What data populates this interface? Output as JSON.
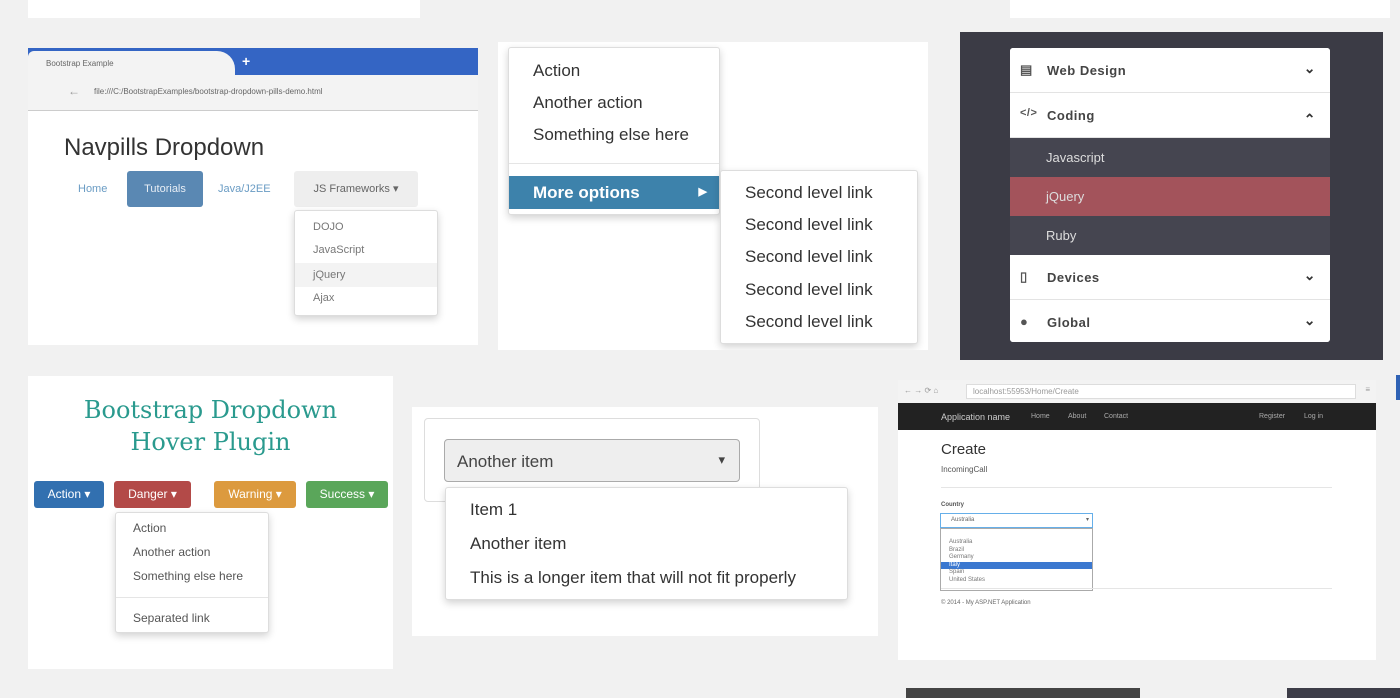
{
  "tile_navpills": {
    "tab_title": "Bootstrap Example",
    "new_tab": "+",
    "url": "file:///C:/BootstrapExamples/bootstrap-dropdown-pills-demo.html",
    "heading": "Navpills Dropdown",
    "pills": [
      "Home",
      "Tutorials",
      "Java/J2EE",
      "JS Frameworks ▾"
    ],
    "active_pill": "Tutorials",
    "dropdown": [
      "DOJO",
      "JavaScript",
      "jQuery",
      "Ajax"
    ],
    "highlighted": "jQuery"
  },
  "tile_multilevel": {
    "items": [
      "Action",
      "Another action",
      "Something else here"
    ],
    "more": "More options",
    "submenu": [
      "Second level link",
      "Second level link",
      "Second level link",
      "Second level link",
      "Second level link"
    ],
    "accent": "#3d82ab"
  },
  "tile_accordion": {
    "sections": [
      {
        "icon": "database-icon",
        "glyph": "▤",
        "label": "Web Design",
        "chevron": "⌄"
      },
      {
        "icon": "code-icon",
        "glyph": "</>",
        "label": "Coding",
        "chevron": "⌃"
      }
    ],
    "sub_items": [
      "Javascript",
      "jQuery",
      "Ruby"
    ],
    "active_sub": "jQuery",
    "sections_after": [
      {
        "icon": "mobile-icon",
        "glyph": "▯",
        "label": "Devices",
        "chevron": "⌄"
      },
      {
        "icon": "globe-icon",
        "glyph": "●",
        "label": "Global",
        "chevron": "⌄"
      }
    ],
    "active_color": "#a3535b"
  },
  "tile_hover": {
    "title_line1": "Bootstrap Dropdown",
    "title_line2": "Hover Plugin",
    "buttons": [
      {
        "label": "Action ▾",
        "color": "#3270b0"
      },
      {
        "label": "Danger ▾",
        "color": "#b34a48"
      },
      {
        "label": "Warning ▾",
        "color": "#dc9a3e"
      },
      {
        "label": "Success ▾",
        "color": "#5aa65a"
      }
    ],
    "dropdown": [
      "Action",
      "Another action",
      "Something else here"
    ],
    "separated": "Separated link"
  },
  "tile_select": {
    "selected": "Another item",
    "caret": "▾",
    "options": [
      "Item 1",
      "Another item",
      "This is a longer item that will not fit properly"
    ]
  },
  "tile_aspnet": {
    "url": "localhost:55953/Home/Create",
    "brand": "Application name",
    "nav": [
      "Home",
      "About",
      "Contact"
    ],
    "nav_right": [
      "Register",
      "Log in"
    ],
    "heading": "Create",
    "subheading": "IncomingCall",
    "field_label": "Country",
    "field_value": "Australia",
    "options": [
      "Australia",
      "Brazil",
      "Germany",
      "Italy",
      "Spain",
      "United States"
    ],
    "highlighted": "Italy",
    "footer": "© 2014 - My ASP.NET Application"
  }
}
